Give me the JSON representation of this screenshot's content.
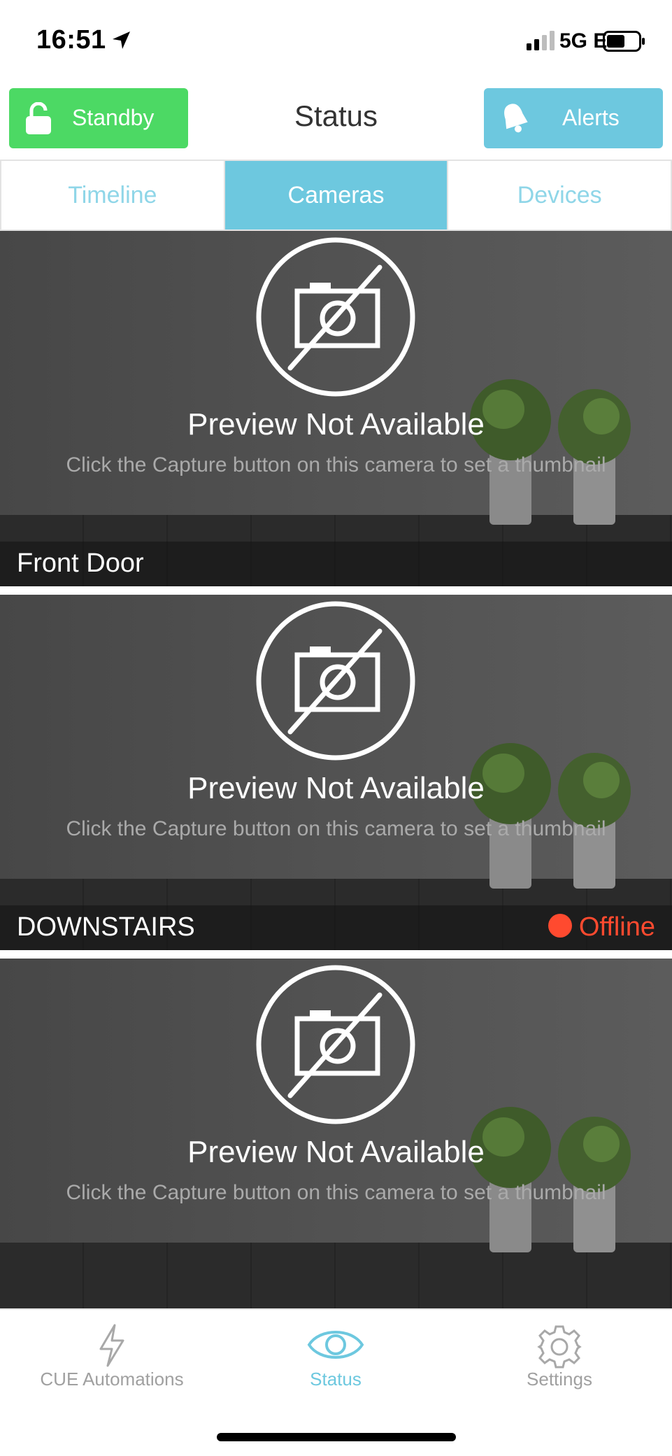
{
  "status_bar": {
    "time": "16:51",
    "network": "5G E",
    "icons": [
      "location-arrow-icon",
      "signal-bars-icon",
      "battery-icon"
    ]
  },
  "header": {
    "title": "Status",
    "standby_label": "Standby",
    "alerts_label": "Alerts",
    "colors": {
      "standby": "#4cd964",
      "alerts": "#6dc8df"
    }
  },
  "tabs": [
    {
      "label": "Timeline",
      "active": false
    },
    {
      "label": "Cameras",
      "active": true
    },
    {
      "label": "Devices",
      "active": false
    }
  ],
  "cameras": [
    {
      "name": "Front Door",
      "preview_title": "Preview Not Available",
      "preview_hint": "Click the Capture button on this camera to set a thumbnail",
      "status": ""
    },
    {
      "name": "DOWNSTAIRS",
      "preview_title": "Preview Not Available",
      "preview_hint": "Click the Capture button on this camera to set a thumbnail",
      "status": "Offline",
      "status_color": "#ff4a2f"
    },
    {
      "name": "",
      "preview_title": "Preview Not Available",
      "preview_hint": "Click the Capture button on this camera to set a thumbnail",
      "status": ""
    }
  ],
  "bottom_nav": [
    {
      "label": "CUE Automations",
      "icon": "lightning-bolt-icon",
      "active": false
    },
    {
      "label": "Status",
      "icon": "eye-icon",
      "active": true
    },
    {
      "label": "Settings",
      "icon": "gear-icon",
      "active": false
    }
  ]
}
